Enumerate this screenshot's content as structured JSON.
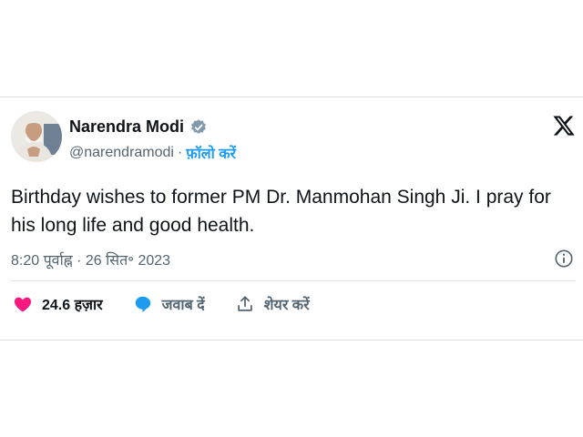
{
  "tweet": {
    "author_name": "Narendra Modi",
    "handle": "@narendramodi",
    "separator": "·",
    "follow_label": "फ़ॉलो करें",
    "text": "Birthday wishes to former PM Dr. Manmohan Singh Ji. I pray for his long life and good health.",
    "timestamp": "8:20 पूर्वाह्न · 26 सित॰ 2023",
    "verified_color": "#829aab",
    "follow_color": "#1d9bf0"
  },
  "actions": {
    "likes": "24.6 हज़ार",
    "reply_label": "जवाब दें",
    "share_label": "शेयर करें",
    "like_color": "#f91880",
    "reply_color": "#1d9bf0"
  },
  "icons": [
    "verified-badge-icon",
    "x-logo-icon",
    "info-icon",
    "heart-icon",
    "reply-bubble-icon",
    "share-icon"
  ]
}
